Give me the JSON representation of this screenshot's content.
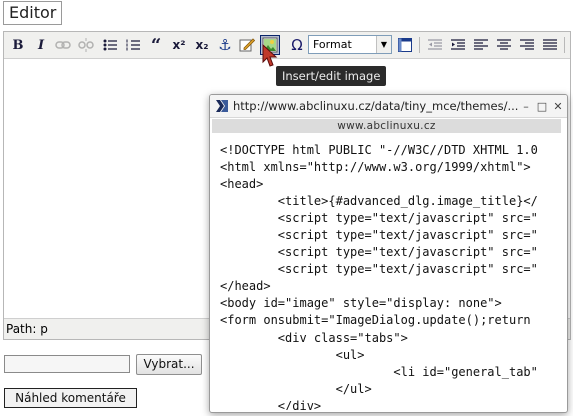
{
  "editor": {
    "legend": "Editor",
    "status_path": "Path: p",
    "tooltip": "Insert/edit image",
    "format_select": {
      "value": "Format"
    }
  },
  "toolbar": {
    "bold_label": "B",
    "italic_label": "I",
    "blockquote_label": "“",
    "superscript_label": "x²",
    "subscript_label": "x₂",
    "anchor_label": "⚓",
    "charmap_label": "Ω"
  },
  "form": {
    "browse_label": "Vybrat...",
    "file_value": "",
    "preview_label": "Náhled komentáře"
  },
  "popup": {
    "title": "http://www.abclinuxu.cz/data/tiny_mce/themes/...",
    "host": "www.abclinuxu.cz",
    "minimize_label": "–",
    "maximize_label": "□",
    "close_label": "✕",
    "source_lines": [
      "<!DOCTYPE html PUBLIC \"-//W3C//DTD XHTML 1.0",
      "<html xmlns=\"http://www.w3.org/1999/xhtml\">",
      "<head>",
      "        <title>{#advanced_dlg.image_title}</",
      "        <script type=\"text/javascript\" src=\"",
      "        <script type=\"text/javascript\" src=\"",
      "        <script type=\"text/javascript\" src=\"",
      "        <script type=\"text/javascript\" src=\"",
      "</head>",
      "<body id=\"image\" style=\"display: none\">",
      "<form onsubmit=\"ImageDialog.update();return",
      "        <div class=\"tabs\">",
      "                <ul>",
      "                        <li id=\"general_tab\"",
      "                </ul>",
      "        </div>"
    ]
  },
  "icons": [
    "bold-icon",
    "italic-icon",
    "link-icon",
    "unlink-icon",
    "bullet-list-icon",
    "numbered-list-icon",
    "blockquote-icon",
    "superscript-icon",
    "subscript-icon",
    "anchor-icon",
    "edit-icon",
    "image-icon",
    "charmap-icon",
    "table-icon",
    "outdent-icon",
    "indent-icon",
    "align-left-icon",
    "align-center-icon",
    "align-right-icon",
    "align-justify-icon",
    "cursor-arrow-icon"
  ],
  "colors": {
    "accent": "#0a246a",
    "tooltip_bg": "#2b2b2b",
    "cursor": "#c0392b"
  }
}
